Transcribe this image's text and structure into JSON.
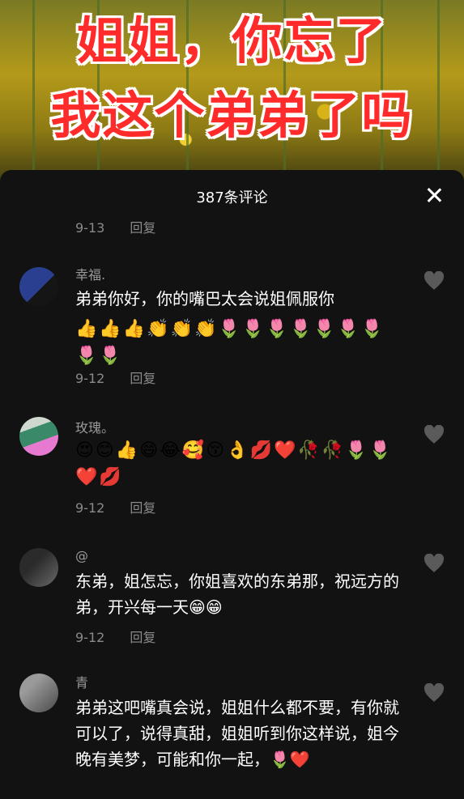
{
  "video": {
    "title_line1": "姐姐，你忘了",
    "title_line2": "我这个弟弟了吗"
  },
  "sheet": {
    "title": "387条评论",
    "close_icon": "close-icon"
  },
  "top_meta": {
    "date": "9-13",
    "reply": "回复"
  },
  "comments": [
    {
      "username": "幸福.",
      "text": "弟弟你好，你的嘴巴太会说姐佩服你",
      "emojis": "👍👍👍👏👏👏🌷🌷🌷🌷🌷🌷🌷🌷🌷",
      "date": "9-12",
      "reply": "回复"
    },
    {
      "username": "玫瑰。",
      "text": "",
      "emojis": "😍😊👍😄😂🥰😚👌💋❤️🥀🥀🌷🌷❤️💋",
      "date": "9-12",
      "reply": "回复"
    },
    {
      "username": "@",
      "text": "东弟，姐怎忘，你姐喜欢的东弟那，祝远方的弟，开兴每一天😁😁",
      "emojis": "",
      "date": "9-12",
      "reply": "回复"
    },
    {
      "username": "青",
      "text": "弟弟这吧嘴真会说，姐姐什么都不要，有你就可以了，说得真甜，姐姐听到你这样说，姐今晚有美梦，可能和你一起，🌷❤️",
      "emojis": "",
      "date": "",
      "reply": ""
    }
  ],
  "colors": {
    "background": "#121212",
    "text": "#ffffff",
    "meta": "#8a8a8a",
    "title_red": "#ff2a2a"
  }
}
